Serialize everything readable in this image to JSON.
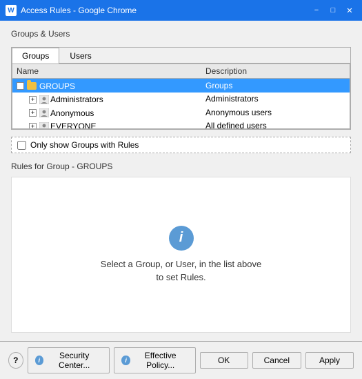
{
  "titleBar": {
    "icon": "W",
    "title": "Access Rules - Google Chrome",
    "minimize": "−",
    "maximize": "□",
    "close": "✕"
  },
  "groupsUsersLabel": "Groups & Users",
  "tabs": [
    {
      "id": "groups",
      "label": "Groups",
      "active": true
    },
    {
      "id": "users",
      "label": "Users",
      "active": false
    }
  ],
  "tableHeaders": [
    {
      "id": "name",
      "label": "Name"
    },
    {
      "id": "description",
      "label": "Description"
    }
  ],
  "treeRows": [
    {
      "id": "groups-root",
      "level": 0,
      "expand": "−",
      "iconType": "folder",
      "name": "GROUPS",
      "description": "Groups",
      "selected": true
    },
    {
      "id": "administrators",
      "level": 1,
      "expand": "+",
      "iconType": "group",
      "name": "Administrators",
      "description": "Administrators",
      "selected": false
    },
    {
      "id": "anonymous",
      "level": 1,
      "expand": "+",
      "iconType": "group",
      "name": "Anonymous",
      "description": "Anonymous users",
      "selected": false
    },
    {
      "id": "everyone",
      "level": 1,
      "expand": "+",
      "iconType": "group",
      "name": "EVERYONE",
      "description": "All defined users",
      "selected": false
    }
  ],
  "checkbox": {
    "label": "Only show Groups with Rules",
    "checked": false
  },
  "rulesSection": {
    "header": "Rules for Group - GROUPS",
    "infoIcon": "i",
    "message": "Select a Group, or User, in the list above\nto set Rules."
  },
  "buttons": {
    "help": "?",
    "securityCenter": "Security Center...",
    "effectivePolicy": "Effective Policy...",
    "ok": "OK",
    "cancel": "Cancel",
    "apply": "Apply"
  }
}
